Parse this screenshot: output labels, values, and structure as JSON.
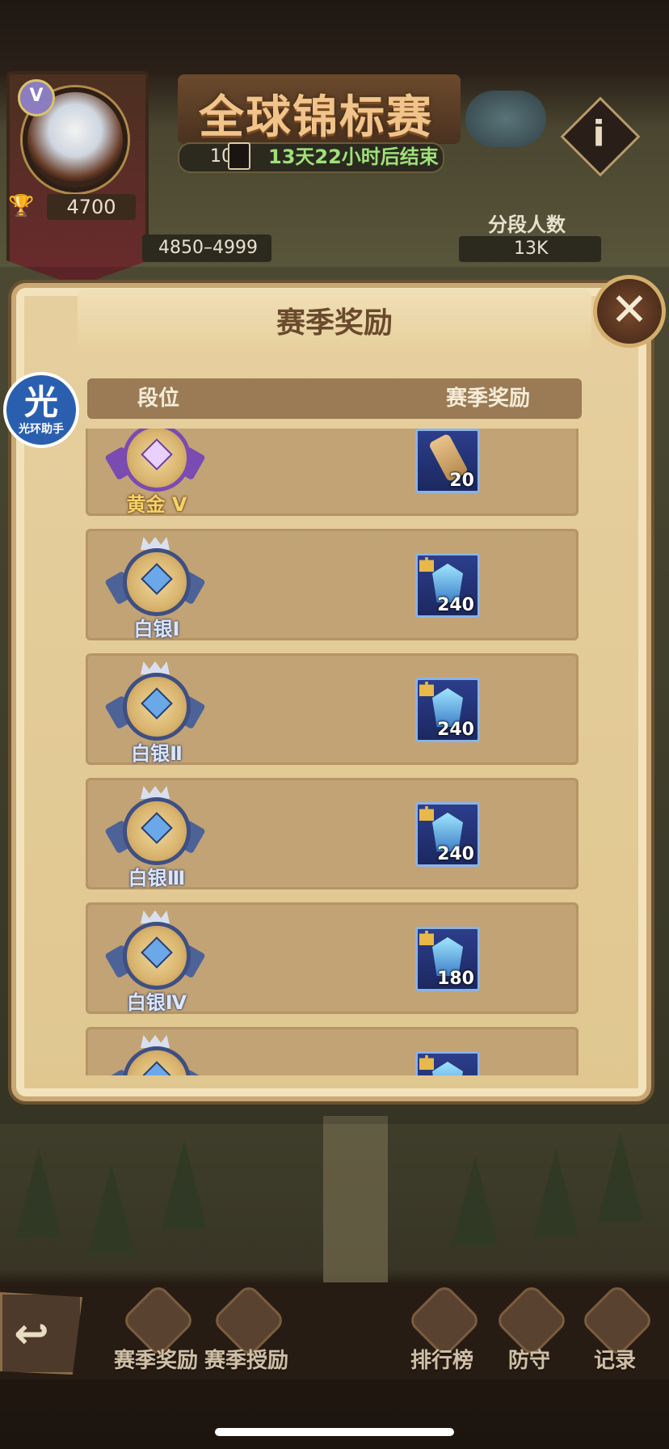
{
  "header": {
    "player_rank_letter": "V",
    "trophies": "4700",
    "title": "全球锦标赛",
    "timer_prefix": "10",
    "timer": "13天22小时后结束",
    "score_range": "4850–4999",
    "segment_count_label": "分段人数",
    "segment_count": "13K"
  },
  "modal": {
    "title": "赛季奖励",
    "columns": {
      "rank": "段位",
      "reward": "赛季奖励"
    },
    "rows": [
      {
        "tier": "黄金 V",
        "style": "gold",
        "reward_type": "scroll",
        "quantity": "20"
      },
      {
        "tier": "白银Ⅰ",
        "style": "silver",
        "reward_type": "crystal",
        "quantity": "240"
      },
      {
        "tier": "白银Ⅱ",
        "style": "silver",
        "reward_type": "crystal",
        "quantity": "240"
      },
      {
        "tier": "白银Ⅲ",
        "style": "silver",
        "reward_type": "crystal",
        "quantity": "240"
      },
      {
        "tier": "白银Ⅳ",
        "style": "silver",
        "reward_type": "crystal",
        "quantity": "180"
      },
      {
        "tier": "",
        "style": "silver",
        "reward_type": "crystal",
        "quantity": ""
      }
    ]
  },
  "overlay": {
    "assistant_glyph": "光",
    "assistant_label": "光环助手"
  },
  "bottom_nav": {
    "items": [
      {
        "label": "赛季奖励"
      },
      {
        "label": "赛季授励"
      },
      {
        "label": "排行榜"
      },
      {
        "label": "防守"
      },
      {
        "label": "记录"
      }
    ]
  },
  "icons": {
    "close": "close-icon",
    "info": "info-icon",
    "back": "back-arrow-icon",
    "trophy": "trophy-icon",
    "hourglass": "hourglass-icon"
  },
  "colors": {
    "panel": "#e6cf9f",
    "row": "#c2a375",
    "header_bar": "#9a7b55",
    "timer_text": "#9fe07a",
    "title_text": "#f0c48a"
  }
}
